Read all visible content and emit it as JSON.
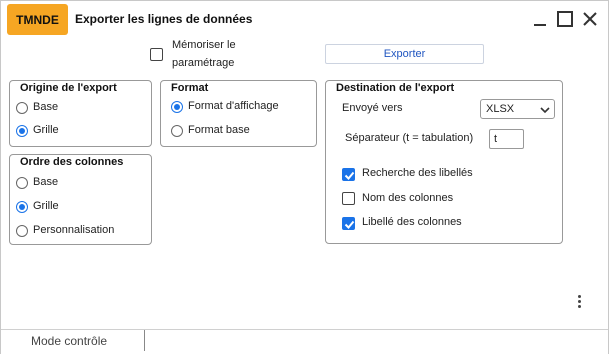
{
  "window": {
    "app_badge": "TMNDE",
    "title": "Exporter les lignes de données",
    "controls": [
      "minimize-icon",
      "maximize-icon",
      "close-icon"
    ]
  },
  "top": {
    "memorize_label_line1": "Mémoriser le",
    "memorize_label_line2": "paramétrage",
    "memorize_checked": false,
    "export_button": "Exporter"
  },
  "origine": {
    "title": "Origine de l'export",
    "options": [
      {
        "label": "Base",
        "selected": false
      },
      {
        "label": "Grille",
        "selected": true
      }
    ]
  },
  "ordre": {
    "title": "Ordre des colonnes",
    "options": [
      {
        "label": "Base",
        "selected": false
      },
      {
        "label": "Grille",
        "selected": true
      },
      {
        "label": "Personnalisation",
        "selected": false
      }
    ]
  },
  "format": {
    "title": "Format",
    "options": [
      {
        "label": "Format d'affichage",
        "selected": true
      },
      {
        "label": "Format base",
        "selected": false
      }
    ]
  },
  "destination": {
    "title": "Destination de l'export",
    "envoye_label": "Envoyé vers",
    "envoye_value": "XLSX",
    "separator_label": "Séparateur (t = tabulation)",
    "separator_value": "t",
    "checkboxes": [
      {
        "label": "Recherche des libellés",
        "checked": true
      },
      {
        "label": "Nom des colonnes",
        "checked": false
      },
      {
        "label": "Libellé des colonnes",
        "checked": true
      }
    ]
  },
  "statusbar": {
    "mode": "Mode contrôle"
  },
  "colors": {
    "accent": "#1a73e8",
    "badge": "#f6a623",
    "export_text": "#1f55c0"
  }
}
